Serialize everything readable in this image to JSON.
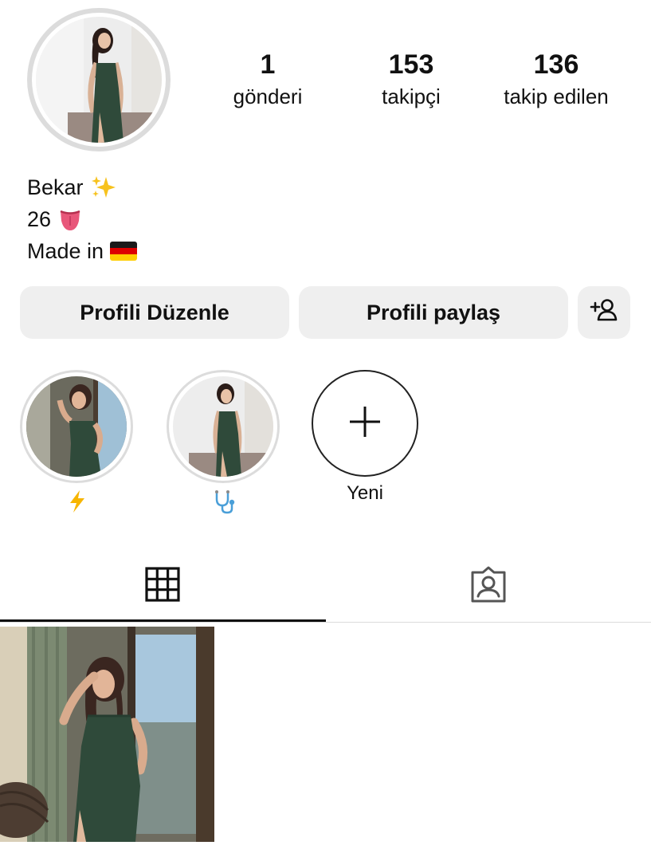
{
  "profile": {
    "stats": {
      "posts_count": "1",
      "posts_label": "gönderi",
      "followers_count": "153",
      "followers_label": "takipçi",
      "following_count": "136",
      "following_label": "takip edilen"
    },
    "bio": {
      "line1": "Bekar",
      "line1_emoji": "sparkles",
      "line2": "26",
      "line2_emoji": "tongue",
      "line3": "Made in",
      "line3_emoji": "flag-germany"
    }
  },
  "actions": {
    "edit_label": "Profili Düzenle",
    "share_label": "Profili paylaş",
    "discover_icon": "add-person-icon"
  },
  "highlights": [
    {
      "label_emoji": "high-voltage"
    },
    {
      "label_emoji": "stethoscope"
    },
    {
      "label": "Yeni",
      "icon": "plus-icon"
    }
  ],
  "tabs": [
    {
      "icon": "grid-icon",
      "active": true
    },
    {
      "icon": "tagged-icon",
      "active": false
    }
  ],
  "colors": {
    "button_bg": "#efefef",
    "dress_green": "#2f4a3a",
    "divider": "#dbdbdb"
  }
}
